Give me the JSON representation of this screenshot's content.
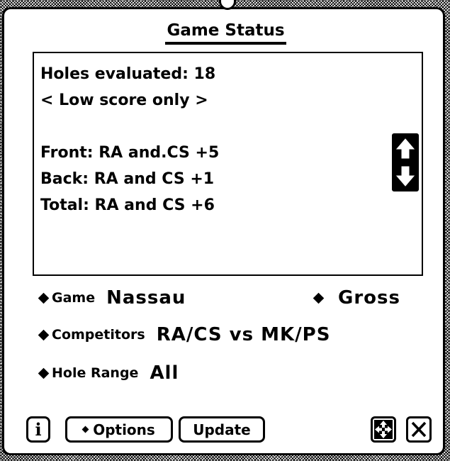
{
  "window": {
    "title": "Game Status"
  },
  "status_text": {
    "lines": [
      "Holes evaluated: 18",
      "< Low score only >",
      "",
      "Front: RA and.CS +5",
      "Back: RA and CS +1",
      "Total: RA and CS +6"
    ]
  },
  "fields": {
    "game": {
      "label": "Game",
      "value": "Nassau"
    },
    "scoring": {
      "value": "Gross"
    },
    "competitors": {
      "label": "Competitors",
      "value": "RA/CS vs MK/PS"
    },
    "hole_range": {
      "label": "Hole Range",
      "value": "All"
    }
  },
  "buttons": {
    "info": "i",
    "options": "Options",
    "update": "Update"
  },
  "icons": {
    "scroll_arrows": "up-down-arrows-icon",
    "move": "four-arrows-move-icon",
    "close": "close-x-icon"
  }
}
